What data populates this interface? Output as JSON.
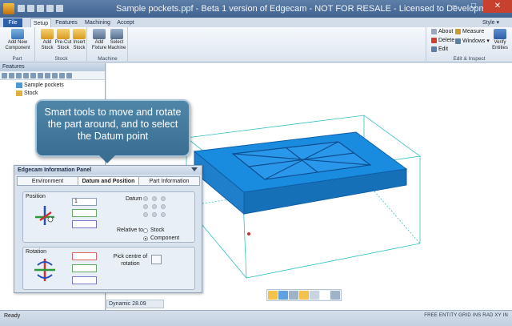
{
  "window": {
    "title": "Sample pockets.ppf - Beta 1 version of Edgecam - NOT FOR RESALE - Licensed to Development"
  },
  "tabs": [
    {
      "label": "File"
    },
    {
      "label": "Setup"
    },
    {
      "label": "Features"
    },
    {
      "label": "Machining"
    },
    {
      "label": "Accept"
    }
  ],
  "style_menu": "Style ▾",
  "ribbon": {
    "part": {
      "label": "Part",
      "add_component": "Add New Component"
    },
    "stock": {
      "label": "Stock",
      "add_stock": "Add Stock",
      "precut_stock": "Pre-Cut Stock",
      "insert_stock": "Insert Stock"
    },
    "machine": {
      "label": "Machine",
      "add_fixture": "Add Fixture",
      "select_machine": "Select Machine"
    },
    "edit_inspect": {
      "label": "Edit & Inspect",
      "about": "About",
      "measure": "Measure",
      "delete": "Delete",
      "windows": "Windows ▾",
      "edit": "Edit",
      "verify": "Verify Entities"
    }
  },
  "features_panel": {
    "title": "Features",
    "tree": [
      {
        "label": "Sample pockets"
      },
      {
        "label": "Stock"
      }
    ]
  },
  "callout": {
    "text": "Smart tools to move and rotate the part around, and to select the Datum point"
  },
  "info_panel": {
    "title": "Edgecam Information Panel",
    "tabs": [
      {
        "label": "Environment"
      },
      {
        "label": "Datum and Position"
      },
      {
        "label": "Part Information"
      }
    ],
    "position": {
      "title": "Position",
      "value": "1",
      "datum_label": "Datum",
      "relative_label": "Relative to",
      "relative_options": [
        {
          "label": "Stock",
          "selected": false
        },
        {
          "label": "Component",
          "selected": true
        }
      ]
    },
    "rotation": {
      "title": "Rotation",
      "pick_label": "Pick centre of rotation"
    }
  },
  "viewport": {
    "dynamic_label": "Dynamic 28.09"
  },
  "status": {
    "left": "Ready",
    "right": "FREE ENTITY GRID INS RAD XY IN"
  },
  "colors": {
    "part_blue": "#1a8ce0",
    "ribbon_accent": "#2d5ea8",
    "callout": "#3f76a0"
  }
}
